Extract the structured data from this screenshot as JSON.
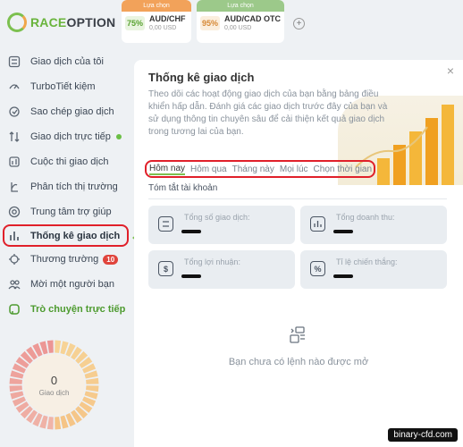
{
  "brand": {
    "name_part1": "RACE",
    "name_part2": "OPTION"
  },
  "assets": [
    {
      "header": "Lựa chọn",
      "payout": "75%",
      "pair": "AUD/CHF",
      "amount": "0,00 USD"
    },
    {
      "header": "Lựa chọn",
      "payout": "95%",
      "pair": "AUD/CAD OTC",
      "amount": "0,00 USD"
    }
  ],
  "add_asset": "+",
  "sidebar": {
    "items": [
      {
        "label": "Giao dịch của tôi",
        "icon": "trades-icon"
      },
      {
        "label": "TurboTiết kiệm",
        "icon": "turbo-icon"
      },
      {
        "label": "Sao chép giao dịch",
        "icon": "copy-icon"
      },
      {
        "label": "Giao dịch trực tiếp",
        "icon": "live-icon"
      },
      {
        "label": "Cuộc thi giao dịch",
        "icon": "contest-icon"
      },
      {
        "label": "Phân tích thị trường",
        "icon": "analysis-icon"
      },
      {
        "label": "Trung tâm trợ giúp",
        "icon": "help-icon"
      },
      {
        "label": "Thống kê giao dịch",
        "icon": "stats-icon"
      },
      {
        "label": "Thương trường",
        "icon": "market-icon",
        "badge": "10"
      },
      {
        "label": "Mời một người bạn",
        "icon": "invite-icon"
      },
      {
        "label": "Trò chuyện trực tiếp",
        "icon": "chat-icon"
      }
    ]
  },
  "gauge": {
    "value": "0",
    "label": "Giao dịch"
  },
  "panel": {
    "title": "Thống kê giao dịch",
    "description": "Theo dõi các hoạt động giao dịch của bạn bằng bảng điều khiển hấp dẫn. Đánh giá các giao dịch trước đây của bạn và sử dụng thông tin chuyên sâu để cải thiện kết quả giao dịch trong tương lai của bạn.",
    "close": "×",
    "tabs": [
      "Hôm nay",
      "Hôm qua",
      "Tháng này",
      "Mọi lúc",
      "Chọn thời gian"
    ],
    "summary_title": "Tóm tắt tài khoản",
    "stats": [
      {
        "label": "Tổng số giao dịch:",
        "icon": "list-icon"
      },
      {
        "label": "Tổng doanh thu:",
        "icon": "bar-chart-icon"
      },
      {
        "label": "Tổng lợi nhuận:",
        "icon": "dollar-icon"
      },
      {
        "label": "Tỉ lệ chiến thắng:",
        "icon": "percent-icon"
      }
    ],
    "empty_text": "Bạn chưa có lệnh nào được mở"
  },
  "watermark": "binary-cfd.com",
  "colors": {
    "brand_green": "#7cc04f",
    "brand_orange": "#f0a64a",
    "highlight_red": "#e0202a"
  }
}
